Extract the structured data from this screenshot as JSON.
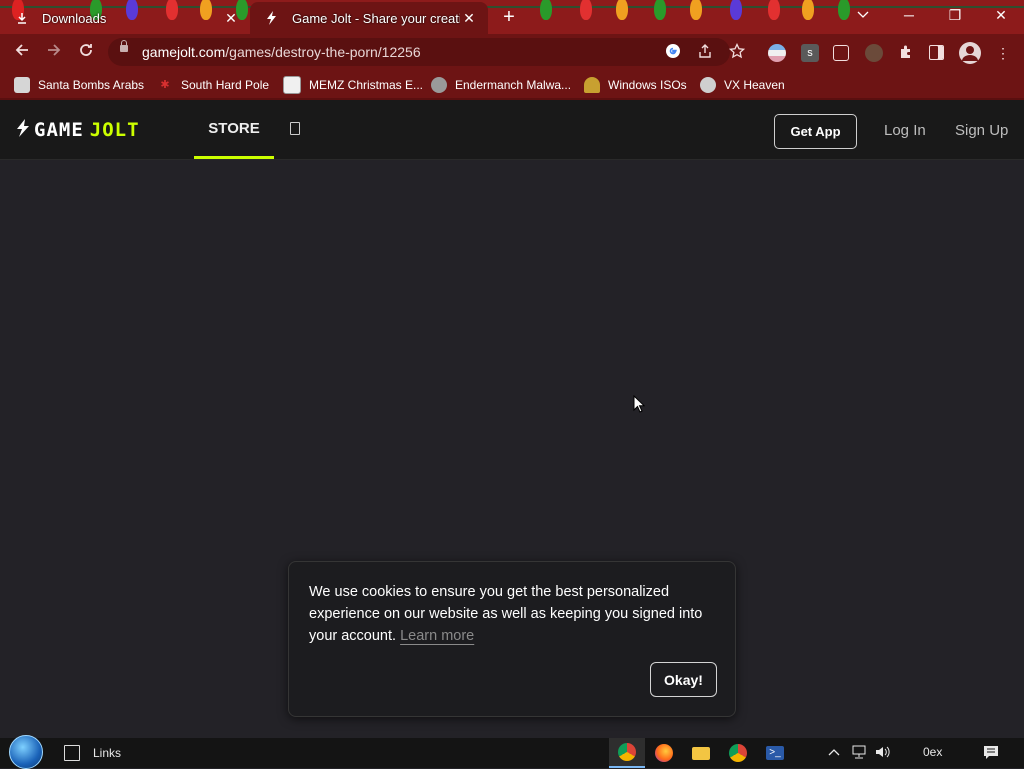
{
  "browser": {
    "tabs": [
      {
        "title": "Downloads",
        "icon": "download-icon",
        "active": false
      },
      {
        "title": "Game Jolt - Share your creations",
        "icon": "gamejolt-icon",
        "active": true
      }
    ],
    "new_tab_symbol": "+",
    "window_controls": {
      "minimize": "─",
      "restore": "❐",
      "close": "✕",
      "tab_search": "⌄"
    },
    "address": {
      "domain": "gamejolt.com",
      "path": "/games/destroy-the-porn/12256"
    },
    "extension_badge": "s",
    "bookmarks": [
      {
        "label": "Santa Bombs Arabs",
        "color": "#d6d6d6"
      },
      {
        "label": "South Hard Pole",
        "color": "#d83030"
      },
      {
        "label": "MEMZ Christmas E...",
        "color": "#f0f0f0"
      },
      {
        "label": "Endermanch Malwa...",
        "color": "#9a9a9a"
      },
      {
        "label": "Windows ISOs",
        "color": "#c8a030"
      },
      {
        "label": "VX Heaven",
        "color": "#cfcfcf"
      }
    ]
  },
  "site": {
    "logo": {
      "game": "GAME",
      "jolt": "JOLT"
    },
    "nav": {
      "store": "STORE"
    },
    "get_app": "Get App",
    "log_in": "Log In",
    "sign_up": "Sign Up",
    "accent_color": "#ccff00"
  },
  "cookie_notice": {
    "message": "We use cookies to ensure you get the best personalized experience on our website as well as keeping you signed into your account.",
    "learn_more": "Learn more",
    "okay": "Okay!"
  },
  "taskbar": {
    "links_label": "Links",
    "apps": [
      "chrome-icon",
      "firefox-icon",
      "file-explorer-icon",
      "chrome-alt-icon",
      "powershell-icon"
    ],
    "clock_partial": "0ex"
  }
}
